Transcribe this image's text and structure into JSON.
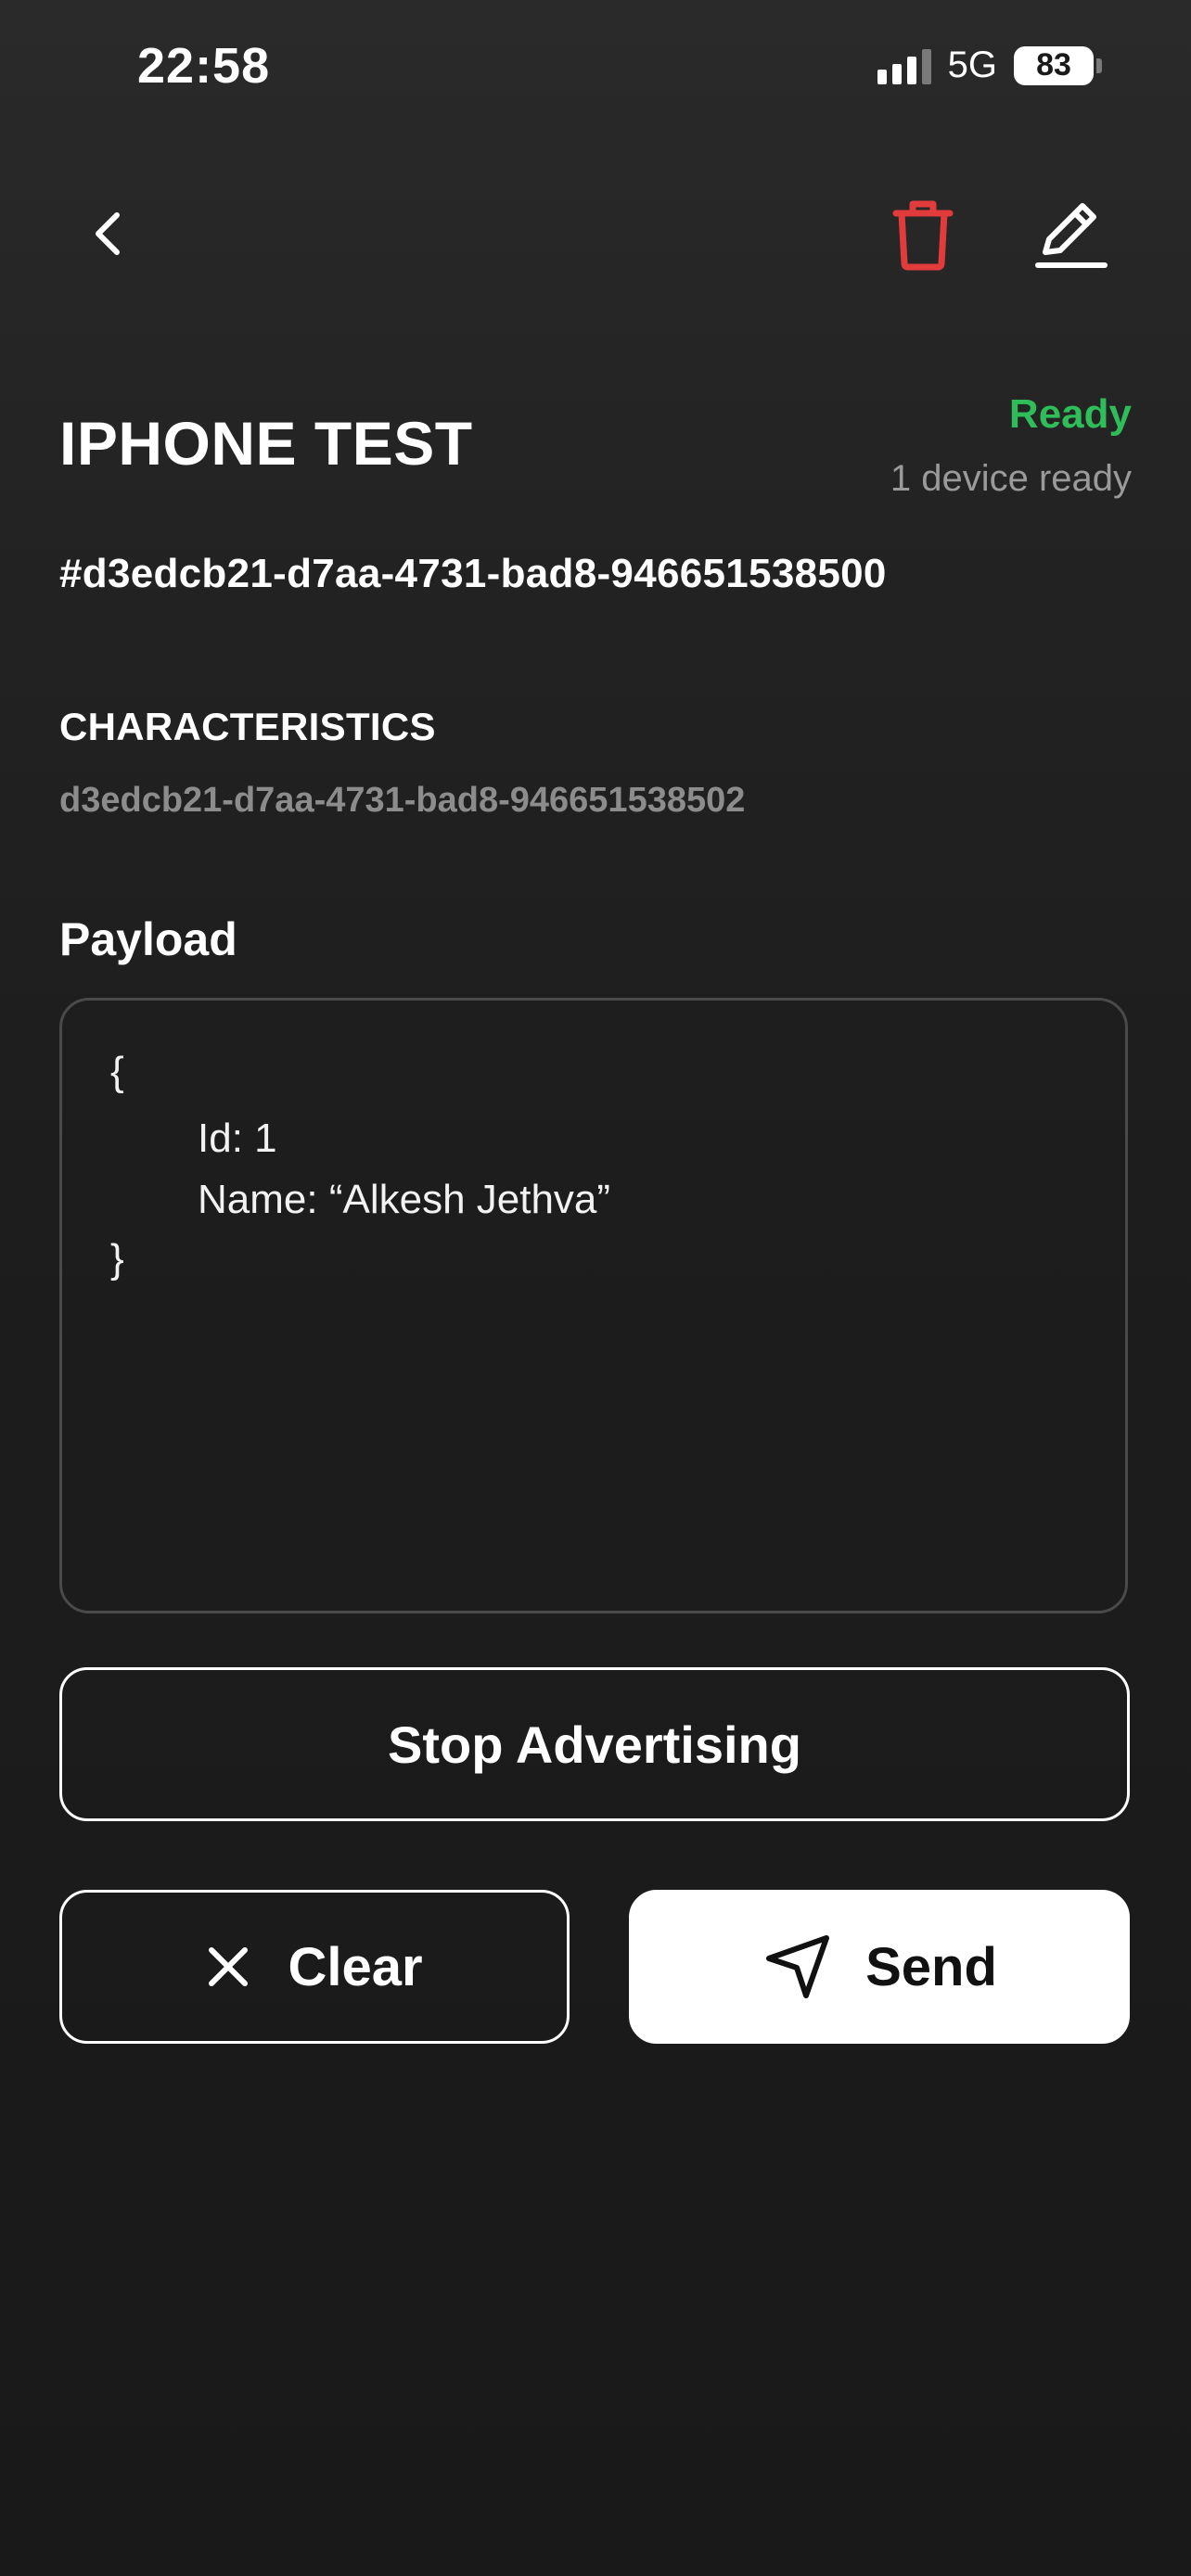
{
  "status_bar": {
    "time": "22:58",
    "network": "5G",
    "battery": "83"
  },
  "icons": {
    "back": "chevron-left-icon",
    "delete": "trash-icon",
    "edit": "pencil-icon",
    "clear": "close-icon",
    "send": "navigation-arrow-icon"
  },
  "colors": {
    "ready": "#2ebd59",
    "delete": "#e23b3b",
    "background": "#1a1a1a"
  },
  "device": {
    "name": "IPHONE TEST",
    "status": "Ready",
    "status_detail": "1 device ready",
    "uuid": "#d3edcb21-d7aa-4731-bad8-946651538500"
  },
  "characteristics": {
    "label": "CHARACTERISTICS",
    "value": "d3edcb21-d7aa-4731-bad8-946651538502"
  },
  "payload": {
    "label": "Payload",
    "lines": [
      "{",
      "Id: 1",
      "Name: “Alkesh Jethva”",
      "}"
    ]
  },
  "buttons": {
    "stop_advertising": "Stop Advertising",
    "clear": "Clear",
    "send": "Send"
  }
}
